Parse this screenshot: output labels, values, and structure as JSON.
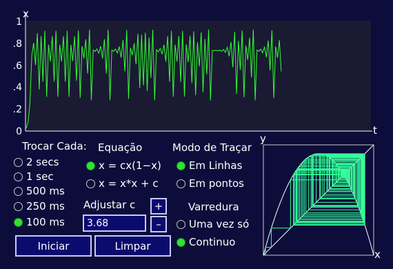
{
  "time_plot": {
    "y_axis_label": "x",
    "x_axis_label": "t",
    "y_ticks": [
      "1",
      ".8",
      ".6",
      ".4",
      ".2",
      "0"
    ],
    "ylim": [
      0,
      1
    ],
    "line_color": "#33ff33",
    "bg_color": "#1a1a33"
  },
  "trocar": {
    "title": "Trocar Cada:",
    "options": [
      "2 secs",
      "1 sec",
      "500 ms",
      "250 ms",
      "100 ms"
    ],
    "selected": "100 ms"
  },
  "equacao": {
    "title": "Equação",
    "options": [
      "x = cx(1−x)",
      "x = x*x + c"
    ],
    "selected": "x = cx(1−x)"
  },
  "modo": {
    "title": "Modo de Traçar",
    "options": [
      "Em Linhas",
      "Em pontos"
    ],
    "selected": "Em Linhas"
  },
  "adjust": {
    "label": "Adjustar c",
    "value": "3.68",
    "plus": "+",
    "minus": "–"
  },
  "varredura": {
    "title": "Varredura",
    "options": [
      "Uma vez só",
      "Continuo"
    ],
    "selected": "Continuo"
  },
  "buttons": {
    "start": "Iniciar",
    "clear": "Limpar"
  },
  "cobweb": {
    "y_label": "y",
    "x_label": "x",
    "line_color": "#33ff99",
    "c": 3.68
  }
}
